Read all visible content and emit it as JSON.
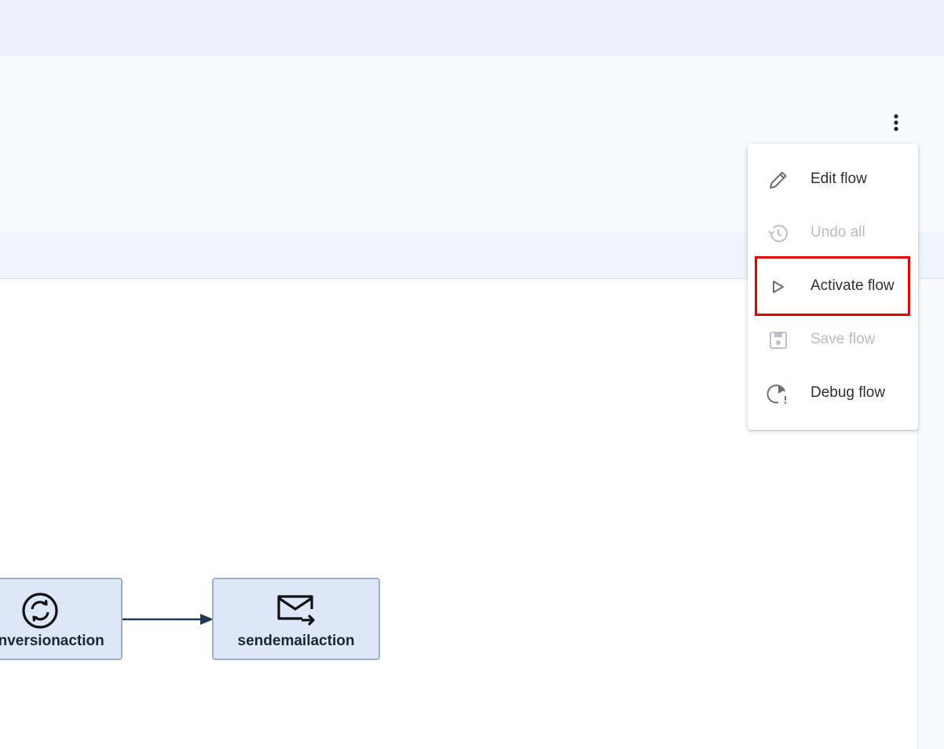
{
  "menu": {
    "items": [
      {
        "label": "Edit flow",
        "icon": "pencil-icon",
        "disabled": false
      },
      {
        "label": "Undo all",
        "icon": "history-icon",
        "disabled": true
      },
      {
        "label": "Activate flow",
        "icon": "play-icon",
        "disabled": false
      },
      {
        "label": "Save flow",
        "icon": "save-icon",
        "disabled": true
      },
      {
        "label": "Debug flow",
        "icon": "debug-icon",
        "disabled": false
      }
    ]
  },
  "flow": {
    "nodes": [
      {
        "label": "onversionaction",
        "icon": "sync-icon"
      },
      {
        "label": "sendemailaction",
        "icon": "email-forward-icon"
      }
    ]
  },
  "colors": {
    "highlight": "#e00000",
    "node_bg": "#dce7f7",
    "node_border": "#9fb0c6",
    "connector": "#213a52"
  }
}
